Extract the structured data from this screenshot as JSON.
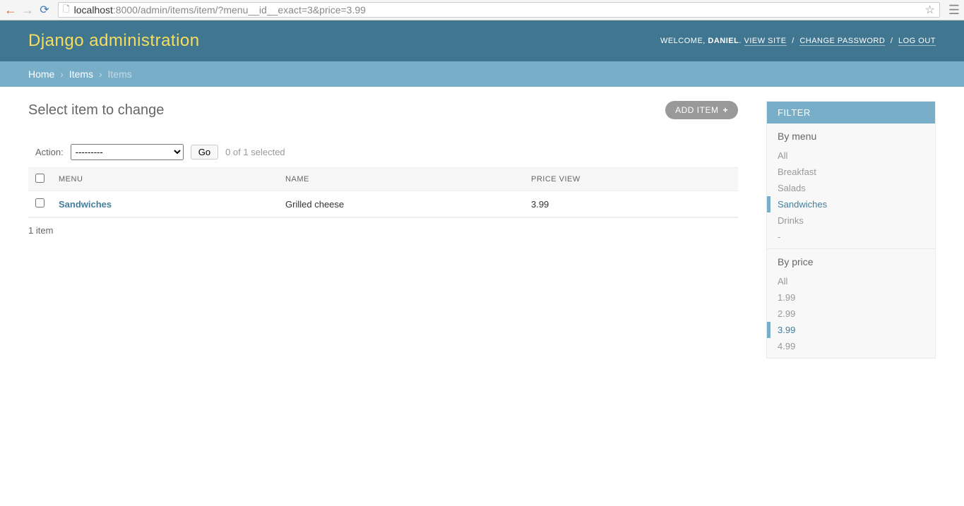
{
  "browser": {
    "url_host": "localhost",
    "url_path": ":8000/admin/items/item/?menu__id__exact=3&price=3.99"
  },
  "header": {
    "branding": "Django administration",
    "welcome": "WELCOME,",
    "user": "DANIEL",
    "view_site": "VIEW SITE",
    "change_password": "CHANGE PASSWORD",
    "log_out": "LOG OUT"
  },
  "breadcrumbs": {
    "home": "Home",
    "section": "Items",
    "current": "Items"
  },
  "page": {
    "title": "Select item to change",
    "add_label": "ADD ITEM"
  },
  "actions": {
    "label": "Action:",
    "placeholder": "---------",
    "go": "Go",
    "counter": "0 of 1 selected"
  },
  "table": {
    "columns": [
      "MENU",
      "NAME",
      "PRICE VIEW"
    ],
    "rows": [
      {
        "menu": "Sandwiches",
        "name": "Grilled cheese",
        "price": "3.99"
      }
    ]
  },
  "paginator": "1 item",
  "filter": {
    "header": "FILTER",
    "sections": [
      {
        "title": "By menu",
        "items": [
          "All",
          "Breakfast",
          "Salads",
          "Sandwiches",
          "Drinks",
          "-"
        ],
        "selected": 3
      },
      {
        "title": "By price",
        "items": [
          "All",
          "1.99",
          "2.99",
          "3.99",
          "4.99"
        ],
        "selected": 3
      }
    ]
  }
}
